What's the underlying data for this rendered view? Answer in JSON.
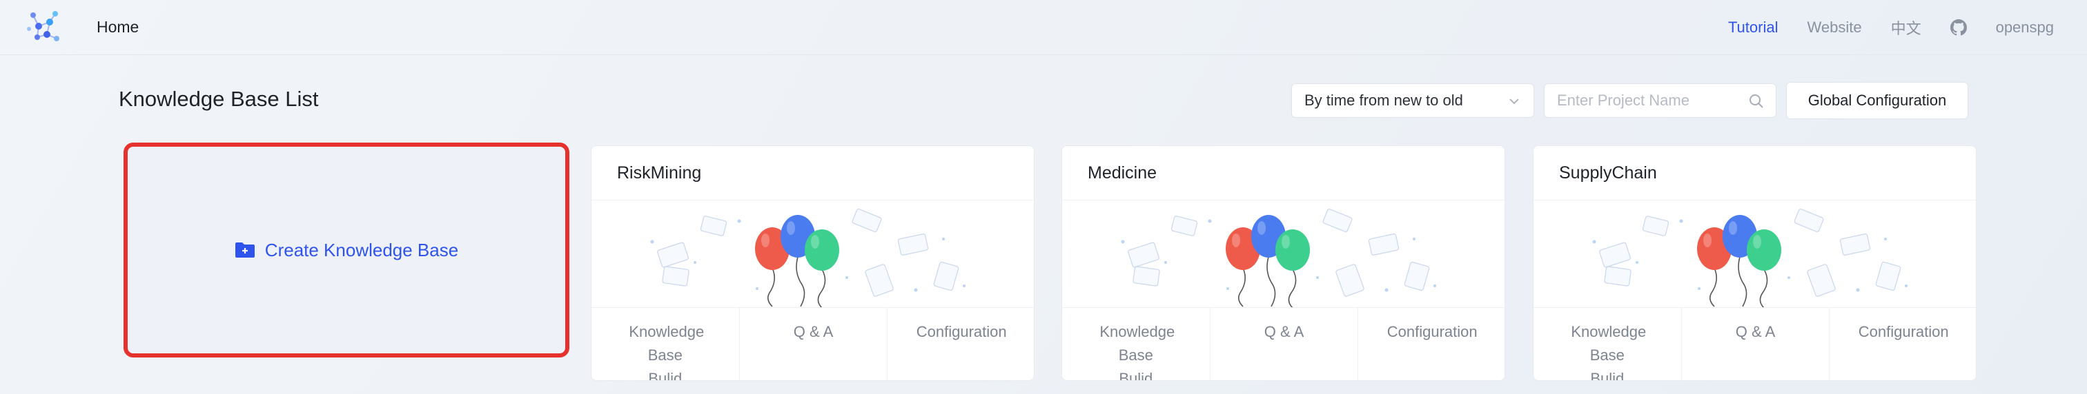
{
  "header": {
    "home_label": "Home",
    "nav": {
      "tutorial": "Tutorial",
      "website": "Website",
      "language": "中文",
      "user": "openspg"
    }
  },
  "page": {
    "title": "Knowledge Base List",
    "sort": {
      "selected": "By time from new to old"
    },
    "search": {
      "placeholder": "Enter Project Name",
      "value": ""
    },
    "global_config_label": "Global Configuration"
  },
  "create_card": {
    "label": "Create Knowledge Base"
  },
  "projects": [
    {
      "name": "RiskMining",
      "actions": [
        "Knowledge Base Bulid",
        "Q & A",
        "Configuration"
      ]
    },
    {
      "name": "Medicine",
      "actions": [
        "Knowledge Base Bulid",
        "Q & A",
        "Configuration"
      ]
    },
    {
      "name": "SupplyChain",
      "actions": [
        "Knowledge Base Bulid",
        "Q & A",
        "Configuration"
      ]
    }
  ],
  "colors": {
    "accent": "#2f54eb",
    "highlight_border": "#e5322d",
    "balloon_red": "#ef5b4a",
    "balloon_blue": "#4a7cf0",
    "balloon_green": "#3ccf8e"
  },
  "icons": {
    "logo": "openspg-logo-icon",
    "github": "github-icon",
    "sort_chevron": "chevron-down-icon",
    "search": "search-icon",
    "create": "folder-plus-icon"
  }
}
